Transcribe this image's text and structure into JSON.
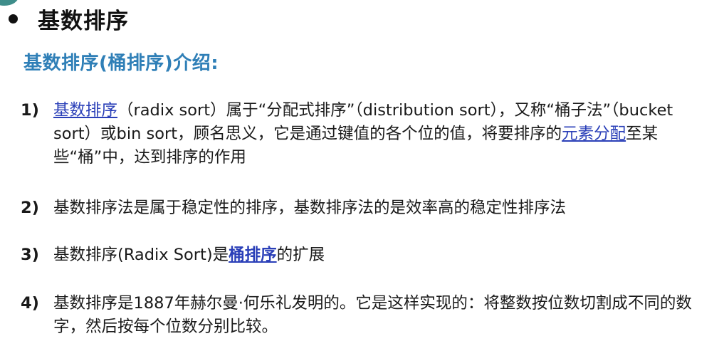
{
  "header": {
    "title": "基数排序",
    "bullet_icon": "bullet-dot-icon",
    "accent_color": "#3e8d8a"
  },
  "intro": {
    "heading": "基数排序(桶排序)介绍:",
    "heading_color": "#2f7fb7"
  },
  "items": [
    {
      "number": "1)",
      "parts": [
        {
          "text": "基数排序",
          "link": true
        },
        {
          "text": "（radix sort）属于“分配式排序”（distribution sort），又称“桶子法”（bucket sort）或bin sort，顾名思义，它是通过键值的各个位的值，将要排序的",
          "link": false
        },
        {
          "text": "元素分配",
          "link": true
        },
        {
          "text": "至某些“桶”中，达到排序的作用",
          "link": false
        }
      ]
    },
    {
      "number": "2)",
      "parts": [
        {
          "text": "基数排序法是属于稳定性的排序，基数排序法的是效率高的稳定性排序法",
          "link": false
        }
      ]
    },
    {
      "number": "3)",
      "parts": [
        {
          "text": "基数排序(Radix Sort)是",
          "link": false
        },
        {
          "text": "桶排序",
          "link": true
        },
        {
          "text": "的扩展",
          "link": false
        }
      ]
    },
    {
      "number": "4)",
      "parts": [
        {
          "text": "基数排序是1887年赫尔曼·何乐礼发明的。它是这样实现的：将整数按位数切割成不同的数字，然后按每个位数分别比较。",
          "link": false
        }
      ]
    }
  ],
  "link_color": "#2a3fb8"
}
